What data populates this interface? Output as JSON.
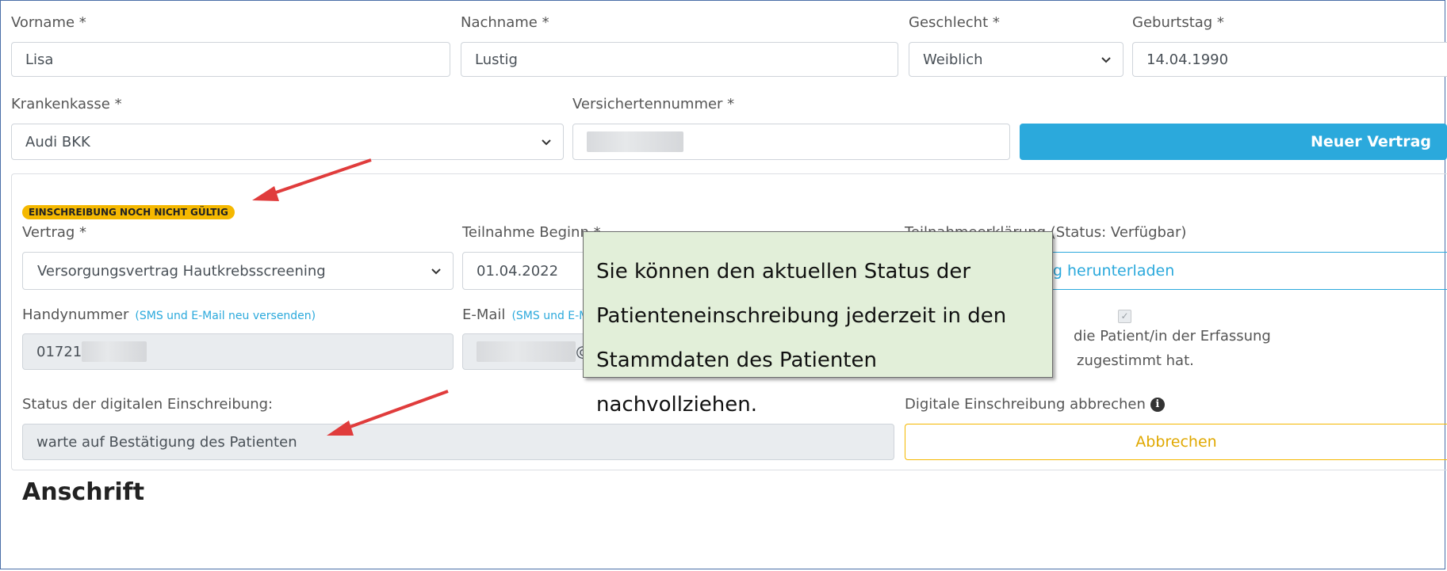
{
  "personal": {
    "vorname_label": "Vorname  *",
    "vorname_value": "Lisa",
    "nachname_label": "Nachname  *",
    "nachname_value": "Lustig",
    "geschlecht_label": "Geschlecht  *",
    "geschlecht_value": "Weiblich",
    "geburtstag_label": "Geburtstag  *",
    "geburtstag_value": "14.04.1990"
  },
  "insurance": {
    "krankenkasse_label": "Krankenkasse  *",
    "krankenkasse_value": "Audi BKK",
    "versichertennummer_label": "Versichertennummer  *",
    "neuer_vertrag_button": "Neuer Vertrag"
  },
  "enrollment": {
    "status_badge": "EINSCHREIBUNG NOCH NICHT GÜLTIG",
    "vertrag_label": "Vertrag  *",
    "vertrag_value": "Versorgungsvertrag Hautkrebsscreening",
    "teilnahme_label": "Teilnahme Beginn  *",
    "teilnahme_value": "01.04.2022",
    "teilnahmeerklaerung_label": "Teilnahmeerklärung (Status: Verfügbar)",
    "download_link": "Teilnahmeerklärung herunterladen",
    "handynummer_label": "Handynummer",
    "resend_link_1": "(SMS und E-Mail neu versenden)",
    "handynummer_value": "01721",
    "email_label": "E-Mail",
    "resend_link_2": "(SMS und E-Mail neu versenden)",
    "email_at": "@",
    "consent_text_1": "die Patient/in der Erfassung",
    "consent_text_2": "zugestimmt hat.",
    "digital_status_label": "Status der digitalen Einschreibung:",
    "digital_status_value": "warte auf Bestätigung des Patienten",
    "abbrechen_label": "Digitale Einschreibung abbrechen",
    "abbrechen_button": "Abbrechen"
  },
  "callout": {
    "line1": "Sie können den aktuellen Status der",
    "line2": "Patienteneinschreibung jederzeit in den",
    "line3": "Stammdaten des Patienten nachvollziehen."
  },
  "next_heading": "Anschrift",
  "colors": {
    "primary": "#2ba9dc",
    "warning": "#f5b800",
    "arrow": "#e03c3c",
    "callout_bg": "#e2efd9"
  }
}
